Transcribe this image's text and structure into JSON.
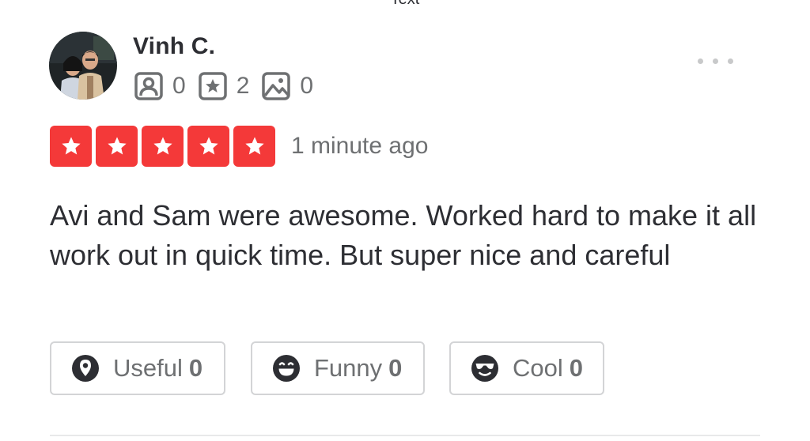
{
  "header": {
    "cut_label": "Text"
  },
  "review": {
    "user_name": "Vinh C.",
    "stats": {
      "friends": "0",
      "reviews": "2",
      "photos": "0"
    },
    "rating_stars": 5,
    "time_ago": "1 minute ago",
    "text": "Avi and Sam were awesome. Worked hard to make it all work out in quick time. But super nice and careful"
  },
  "reactions": {
    "useful_label": "Useful",
    "useful_count": "0",
    "funny_label": "Funny",
    "funny_count": "0",
    "cool_label": "Cool",
    "cool_count": "0"
  },
  "icons": {
    "friends": "friends-icon",
    "reviews": "star-review-icon",
    "photos": "photo-icon",
    "more": "more-dots-icon",
    "useful": "useful-icon",
    "funny": "funny-face-icon",
    "cool": "sunglasses-face-icon"
  },
  "colors": {
    "star_red": "#f43939",
    "text_dark": "#2d2e33",
    "text_gray": "#6e7072",
    "border": "#d3d4d6"
  }
}
